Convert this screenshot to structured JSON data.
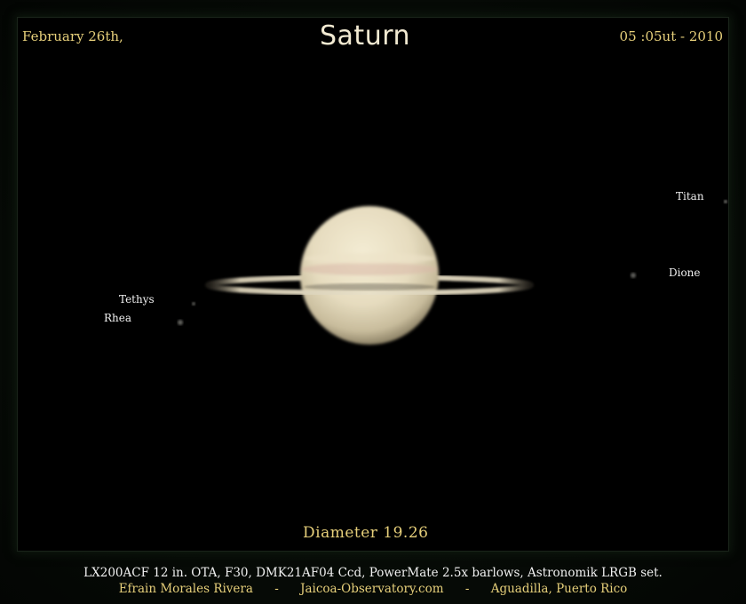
{
  "header": {
    "date": "February 26th,",
    "title": "Saturn",
    "time": "05 :05ut - 2010"
  },
  "moons": {
    "titan": "Titan",
    "dione": "Dione",
    "tethys": "Tethys",
    "rhea": "Rhea"
  },
  "diameter": "Diameter 19.26",
  "footer": {
    "equipment": "LX200ACF 12 in. OTA, F30, DMK21AF04 Ccd, PowerMate 2.5x barlows, Astronomik LRGB set.",
    "author": "Efrain Morales Rivera",
    "separator": "-",
    "website": "Jaicoa-Observatory.com",
    "location": "Aguadilla, Puerto Rico"
  },
  "colors": {
    "label_gold": "#e6cf7a",
    "label_white": "#f0f0f0",
    "background": "#000000"
  }
}
